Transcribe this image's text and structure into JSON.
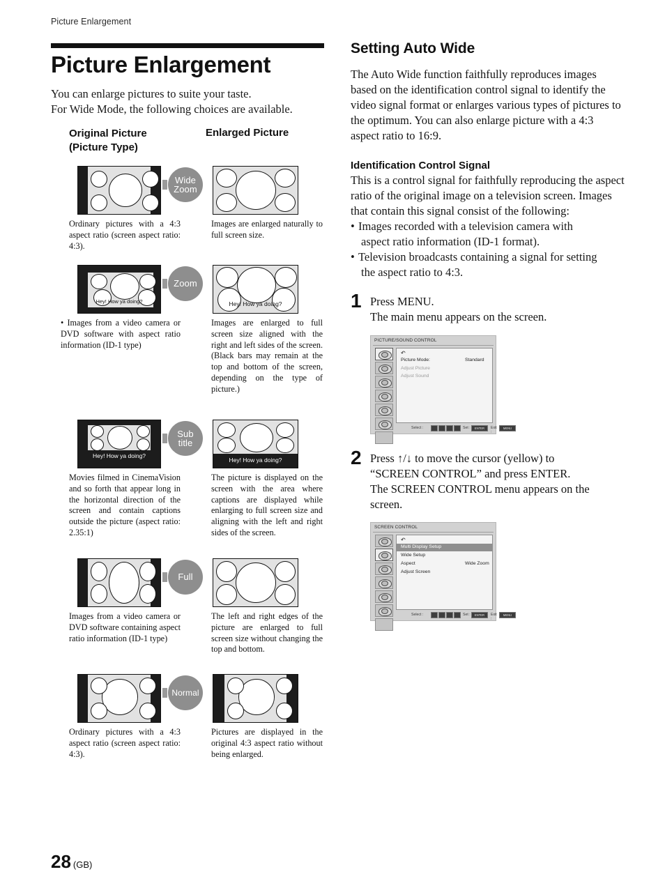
{
  "running_header": "Picture Enlargement",
  "title": "Picture Enlargement",
  "intro_line1": "You can enlarge pictures to suite your taste.",
  "intro_line2": "For Wide Mode, the following choices are available.",
  "table_head": {
    "original_l1": "Original Picture",
    "original_l2": "(Picture Type)",
    "enlarged": "Enlarged Picture"
  },
  "modes": [
    {
      "badge_l1": "Wide",
      "badge_l2": "Zoom",
      "caption_left": "Ordinary pictures with a 4:3 aspect ratio (screen aspect ratio: 4:3).",
      "caption_right": "Images are enlarged naturally to full screen size.",
      "subtitle_text": ""
    },
    {
      "badge_l1": "Zoom",
      "badge_l2": "",
      "caption_left": "• Images from a video camera or DVD software with aspect ratio information (ID-1 type)",
      "caption_right": "Images are enlarged to full screen size aligned with the right and left sides of the screen. (Black bars may remain at the top and bottom of the screen, depending on the type of picture.)",
      "subtitle_text": "Hey! How ya doing?"
    },
    {
      "badge_l1": "Sub",
      "badge_l2": "title",
      "caption_left": "Movies filmed in CinemaVision and so forth that appear long in the horizontal direction of the screen and contain captions outside the picture (aspect ratio: 2.35:1)",
      "caption_right": "The picture is displayed on the screen with the area where captions are displayed while enlarging to full screen size and aligning with the left and right sides of the screen.",
      "subtitle_text": "Hey! How ya doing?"
    },
    {
      "badge_l1": "Full",
      "badge_l2": "",
      "caption_left": "Images from a video camera or DVD software containing aspect ratio information (ID-1 type)",
      "caption_right": "The left and right edges of the picture are enlarged to full screen size without changing the top and bottom.",
      "subtitle_text": ""
    },
    {
      "badge_l1": "Normal",
      "badge_l2": "",
      "caption_left": "Ordinary pictures with a 4:3 aspect ratio (screen aspect ratio: 4:3).",
      "caption_right": "Pictures are displayed in the original 4:3 aspect ratio without being enlarged.",
      "subtitle_text": ""
    }
  ],
  "right": {
    "section_title": "Setting Auto Wide",
    "section_body": "The Auto Wide function faithfully reproduces images based on the identification control signal to identify the video signal format or enlarges various types of pictures to the optimum. You can also enlarge picture with a 4:3 aspect ratio to 16:9.",
    "sub_title": "Identification Control Signal",
    "sub_body": "This is a control signal for faithfully reproducing the aspect ratio of the original image on a television screen. Images that contain this signal consist of the following:",
    "bullets": [
      {
        "line1": "Images recorded with a television camera with",
        "line2": "aspect ratio information (ID-1 format)."
      },
      {
        "line1": "Television broadcasts containing a signal for setting",
        "line2": "the aspect ratio to 4:3."
      }
    ],
    "steps": [
      {
        "num": "1",
        "line1": "Press MENU.",
        "line2": "The main menu appears on the screen."
      },
      {
        "num": "2",
        "line1": "Press ↑/↓ to move the cursor (yellow) to",
        "line2": "“SCREEN CONTROL” and press ENTER.",
        "line3": "The SCREEN CONTROL menu appears on the",
        "line4": "screen."
      }
    ],
    "osd1": {
      "title": "PICTURE/SOUND CONTROL",
      "back_glyph": "↶",
      "rows": [
        {
          "label": "Picture Mode:",
          "value": "Standard",
          "state": "normal"
        },
        {
          "label": "Adjust Picture",
          "value": "",
          "state": "dim"
        },
        {
          "label": "Adjust Sound",
          "value": "",
          "state": "dim"
        }
      ],
      "foot_select": "Select :",
      "foot_set": "Set :",
      "foot_set_key": "ENTER",
      "foot_exit": "Exit :",
      "foot_exit_key": "MENU"
    },
    "osd2": {
      "title": "SCREEN CONTROL",
      "back_glyph": "↶",
      "rows": [
        {
          "label": "Multi Display Setup",
          "value": "",
          "state": "highlight"
        },
        {
          "label": "Wide Setup",
          "value": "",
          "state": "normal"
        },
        {
          "label": "Aspect",
          "value": "Wide Zoom",
          "state": "normal"
        },
        {
          "label": "Adjust Screen",
          "value": "",
          "state": "normal"
        }
      ],
      "foot_select": "Select :",
      "foot_set": "Set :",
      "foot_set_key": "ENTER",
      "foot_exit": "Exit :",
      "foot_exit_key": "MENU"
    }
  },
  "footer": {
    "page_number": "28",
    "edition": "(GB)"
  }
}
